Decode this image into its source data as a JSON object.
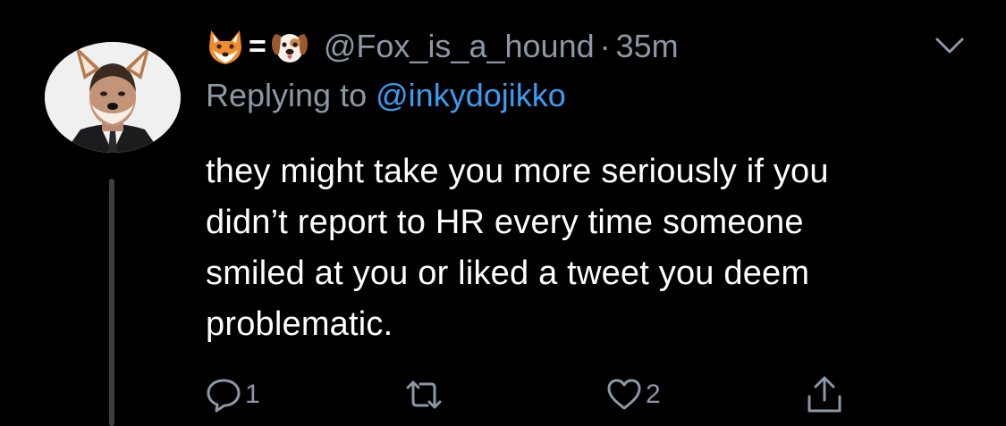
{
  "tweet": {
    "display_name_emojis": [
      "fox-face-emoji",
      "equals-sign",
      "dog-face-emoji"
    ],
    "equals": "=",
    "handle": "@Fox_is_a_hound",
    "separator": "·",
    "time": "35m",
    "replying_prefix": "Replying to",
    "replying_to": "@inkydojikko",
    "text_lines": [
      "they might take you more seriously if you",
      "didn’t report to HR every time someone",
      "smiled at you or liked a tweet you deem",
      "problematic."
    ],
    "actions": {
      "reply_count": "1",
      "retweet_count": "",
      "like_count": "2"
    }
  },
  "colors": {
    "background": "#000000",
    "text": "#ffffff",
    "secondary": "#8b98a5",
    "link": "#3b9cf0",
    "thread_line": "#3b4046"
  },
  "icons": [
    "chevron-down-icon",
    "reply-icon",
    "retweet-icon",
    "like-icon",
    "share-icon"
  ]
}
